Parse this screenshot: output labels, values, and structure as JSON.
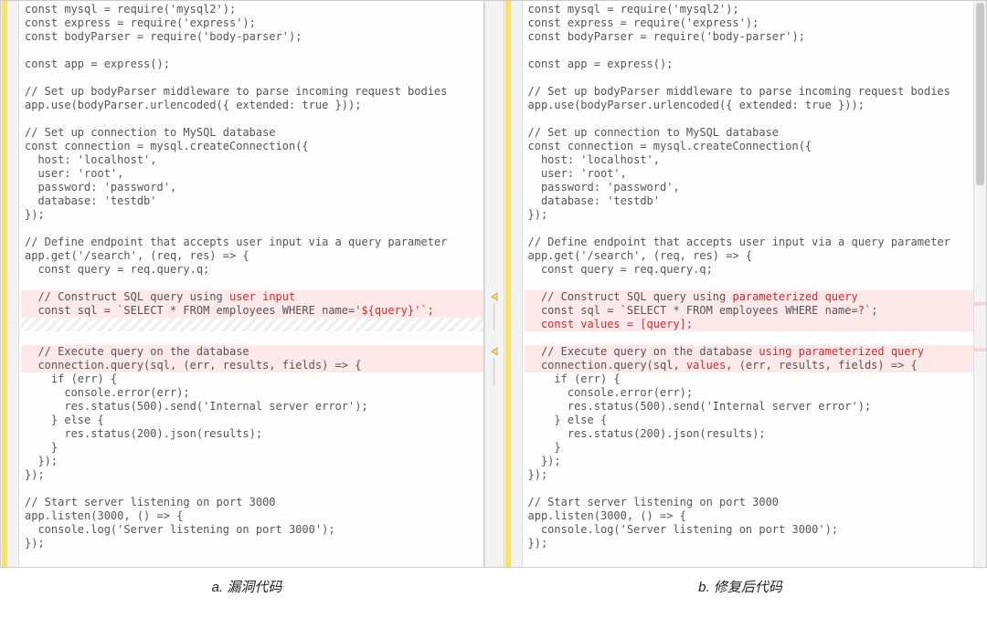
{
  "captions": {
    "left": "a. 漏洞代码",
    "right": "b. 修复后代码"
  },
  "left": {
    "lines": [
      {
        "t": "const mysql = require('mysql2');"
      },
      {
        "t": "const express = require('express');"
      },
      {
        "t": "const bodyParser = require('body-parser');"
      },
      {
        "t": ""
      },
      {
        "t": "const app = express();"
      },
      {
        "t": ""
      },
      {
        "t": "// Set up bodyParser middleware to parse incoming request bodies"
      },
      {
        "t": "app.use(bodyParser.urlencoded({ extended: true }));"
      },
      {
        "t": ""
      },
      {
        "t": "// Set up connection to MySQL database"
      },
      {
        "t": "const connection = mysql.createConnection({"
      },
      {
        "t": "  host: 'localhost',"
      },
      {
        "t": "  user: 'root',"
      },
      {
        "t": "  password: 'password',"
      },
      {
        "t": "  database: 'testdb'"
      },
      {
        "t": "});"
      },
      {
        "t": ""
      },
      {
        "t": "// Define endpoint that accepts user input via a query parameter"
      },
      {
        "t": "app.get('/search', (req, res) => {"
      },
      {
        "t": "  const query = req.query.q;"
      },
      {
        "t": ""
      },
      {
        "cls": "hl-pink",
        "segs": [
          {
            "t": "  // Construct SQL query using "
          },
          {
            "t": "user input",
            "cls": "hl-red-text"
          }
        ]
      },
      {
        "cls": "hl-pink",
        "segs": [
          {
            "t": "  const sql = `SELECT * FROM employees WHERE name="
          },
          {
            "t": "'${query}'`;",
            "cls": "hl-red-text"
          }
        ]
      },
      {
        "cls": "striped",
        "t": " "
      },
      {
        "t": ""
      },
      {
        "cls": "hl-pink",
        "t": "  // Execute query on the database"
      },
      {
        "cls": "hl-pink",
        "t": "  connection.query(sql, (err, results, fields) => {"
      },
      {
        "t": "    if (err) {"
      },
      {
        "t": "      console.error(err);"
      },
      {
        "t": "      res.status(500).send('Internal server error');"
      },
      {
        "t": "    } else {"
      },
      {
        "t": "      res.status(200).json(results);"
      },
      {
        "t": "    }"
      },
      {
        "t": "  });"
      },
      {
        "t": "});"
      },
      {
        "t": ""
      },
      {
        "t": "// Start server listening on port 3000"
      },
      {
        "t": "app.listen(3000, () => {"
      },
      {
        "t": "  console.log('Server listening on port 3000');"
      },
      {
        "t": "});"
      }
    ]
  },
  "right": {
    "lines": [
      {
        "t": "const mysql = require('mysql2');"
      },
      {
        "t": "const express = require('express');"
      },
      {
        "t": "const bodyParser = require('body-parser');"
      },
      {
        "t": ""
      },
      {
        "t": "const app = express();"
      },
      {
        "t": ""
      },
      {
        "t": "// Set up bodyParser middleware to parse incoming request bodies"
      },
      {
        "t": "app.use(bodyParser.urlencoded({ extended: true }));"
      },
      {
        "t": ""
      },
      {
        "t": "// Set up connection to MySQL database"
      },
      {
        "t": "const connection = mysql.createConnection({"
      },
      {
        "t": "  host: 'localhost',"
      },
      {
        "t": "  user: 'root',"
      },
      {
        "t": "  password: 'password',"
      },
      {
        "t": "  database: 'testdb'"
      },
      {
        "t": "});"
      },
      {
        "t": ""
      },
      {
        "t": "// Define endpoint that accepts user input via a query parameter"
      },
      {
        "t": "app.get('/search', (req, res) => {"
      },
      {
        "t": "  const query = req.query.q;"
      },
      {
        "t": ""
      },
      {
        "cls": "hl-pink",
        "segs": [
          {
            "t": "  // Construct SQL query using "
          },
          {
            "t": "parameterized query",
            "cls": "hl-red-text"
          }
        ]
      },
      {
        "cls": "hl-pink",
        "segs": [
          {
            "t": "  const sql = `SELECT * FROM employees WHERE name="
          },
          {
            "t": "?",
            "cls": "hl-red-text"
          },
          {
            "t": "`;"
          }
        ]
      },
      {
        "cls": "hl-pink",
        "segs": [
          {
            "t": "  "
          },
          {
            "t": "const values = [query];",
            "cls": "hl-red-text"
          }
        ]
      },
      {
        "t": ""
      },
      {
        "cls": "hl-pink",
        "segs": [
          {
            "t": "  // Execute query on the database "
          },
          {
            "t": "using parameterized query",
            "cls": "hl-red-text"
          }
        ]
      },
      {
        "cls": "hl-pink",
        "segs": [
          {
            "t": "  connection.query(sql, "
          },
          {
            "t": "values,",
            "cls": "hl-red-text"
          },
          {
            "t": " (err, results, fields) => {"
          }
        ]
      },
      {
        "t": "    if (err) {"
      },
      {
        "t": "      console.error(err);"
      },
      {
        "t": "      res.status(500).send('Internal server error');"
      },
      {
        "t": "    } else {"
      },
      {
        "t": "      res.status(200).json(results);"
      },
      {
        "t": "    }"
      },
      {
        "t": "  });"
      },
      {
        "t": "});"
      },
      {
        "t": ""
      },
      {
        "t": "// Start server listening on port 3000"
      },
      {
        "t": "app.listen(3000, () => {"
      },
      {
        "t": "  console.log('Server listening on port 3000');"
      },
      {
        "t": "});"
      }
    ]
  },
  "arrows": [
    {
      "topLine": 21
    },
    {
      "topLine": 25
    }
  ]
}
